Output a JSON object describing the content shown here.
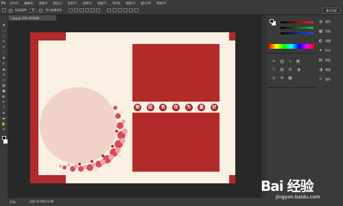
{
  "app": {
    "logo": "Ps"
  },
  "menu": [
    "文件(F)",
    "编辑(E)",
    "图像(I)",
    "图层(L)",
    "类型(Y)",
    "选择(S)",
    "滤镜(T)",
    "3D(D)",
    "视图(V)",
    "窗口(W)",
    "帮助(H)"
  ],
  "options": {
    "auto_select_label": "自动选择:",
    "layer_select": "组",
    "show_transform_label": "显示变换控件"
  },
  "workspace": "基本功能",
  "document": {
    "tab_title": "1.jpg @ 25% (RGB/8)"
  },
  "canvas": {
    "title_chars": [
      "相",
      "因",
      "有",
      "你",
      "为",
      "最",
      "好"
    ]
  },
  "status": {
    "zoom": "25%",
    "doc_size": "文档:24.9M/24.9M"
  },
  "side_panel": {
    "items": [
      "颜色",
      "色板",
      "调整",
      "样式",
      "图层",
      "通道",
      "路径"
    ]
  },
  "watermark": {
    "logo": "Bai 经验",
    "url": "jingyan.baidu.com"
  },
  "colors": {
    "frame_red": "#b22a2a",
    "canvas_bg": "#fbf0e4",
    "circle": "#f0d2c8",
    "ui_dark": "#282828"
  }
}
